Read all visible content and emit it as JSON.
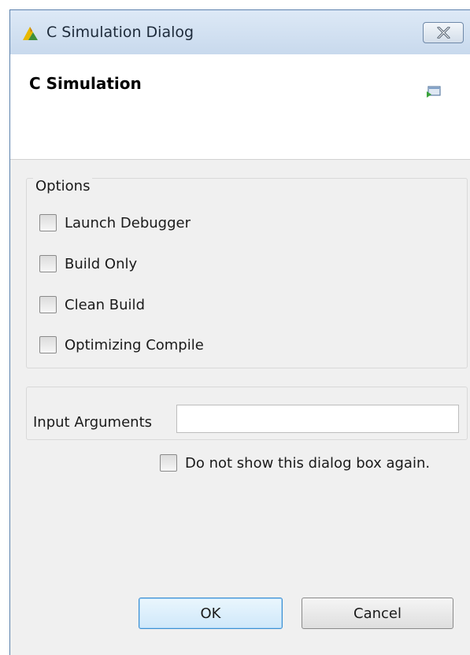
{
  "window": {
    "title": "C Simulation Dialog",
    "app_icon": "xilinx-logo-icon",
    "close_icon": "close-icon"
  },
  "header": {
    "title": "C Simulation",
    "icon": "monitor-icon"
  },
  "options": {
    "group_label": "Options",
    "checkboxes": [
      {
        "label": "Launch Debugger",
        "checked": false
      },
      {
        "label": "Build Only",
        "checked": false
      },
      {
        "label": "Clean Build",
        "checked": false
      },
      {
        "label": "Optimizing Compile",
        "checked": false
      }
    ]
  },
  "input_arguments": {
    "label": "Input Arguments",
    "value": ""
  },
  "dont_show": {
    "label": "Do not show this dialog box again.",
    "checked": false
  },
  "buttons": {
    "ok": "OK",
    "cancel": "Cancel"
  }
}
